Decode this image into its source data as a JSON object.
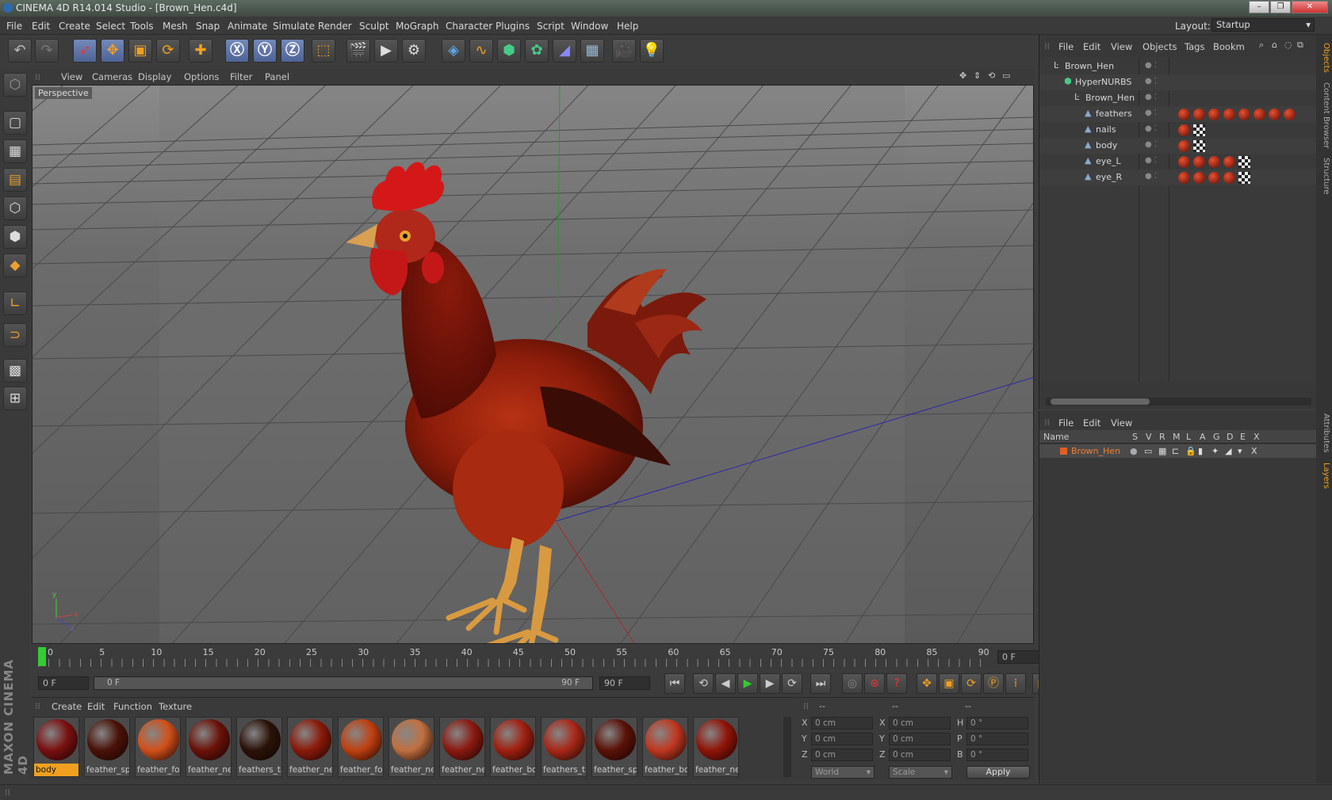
{
  "window": {
    "title": "CINEMA 4D R14.014 Studio - [Brown_Hen.c4d]",
    "layout_label": "Layout:",
    "layout_value": "Startup"
  },
  "menu": [
    "File",
    "Edit",
    "Create",
    "Select",
    "Tools",
    "Mesh",
    "Snap",
    "Animate",
    "Simulate",
    "Render",
    "Sculpt",
    "MoGraph",
    "Character",
    "Plugins",
    "Script",
    "Window",
    "Help"
  ],
  "toolbar_icons": [
    "undo-icon",
    "redo-icon",
    "live-select-icon",
    "move-icon",
    "scale-icon",
    "rotate-icon",
    "add-icon",
    "x-axis-icon",
    "y-axis-icon",
    "z-axis-icon",
    "coordinate-system-icon",
    "render-view-icon",
    "render-picture-icon",
    "render-settings-icon",
    "cube-icon",
    "spline-icon",
    "nurbs-icon",
    "array-icon",
    "deformer-icon",
    "floor-icon",
    "camera-icon",
    "light-icon"
  ],
  "viewport": {
    "menu": [
      "View",
      "Cameras",
      "Display",
      "Options",
      "Filter",
      "Panel"
    ],
    "label": "Perspective",
    "axis_labels": {
      "x": "x",
      "y": "y",
      "z": "z"
    }
  },
  "timeline": {
    "ticks": [
      "0",
      "5",
      "10",
      "15",
      "20",
      "25",
      "30",
      "35",
      "40",
      "45",
      "50",
      "55",
      "60",
      "65",
      "70",
      "75",
      "80",
      "85",
      "90"
    ],
    "current_frame": "0 F"
  },
  "transport": {
    "start": "0 F",
    "range_start": "0 F",
    "range_end": "90 F",
    "end": "90 F"
  },
  "materials": {
    "menu": [
      "Create",
      "Edit",
      "Function",
      "Texture"
    ],
    "items": [
      {
        "name": "body",
        "color": "#7a1010",
        "selected": true
      },
      {
        "name": "feather_spi",
        "color": "#4a1208"
      },
      {
        "name": "feather_foo",
        "color": "#d0501a"
      },
      {
        "name": "feather_ne",
        "color": "#6a1208"
      },
      {
        "name": "feathers_ta",
        "color": "#2a1208"
      },
      {
        "name": "feather_ne",
        "color": "#8a1a0a"
      },
      {
        "name": "feather_foo",
        "color": "#c04010"
      },
      {
        "name": "feather_ne",
        "color": "#c07040"
      },
      {
        "name": "feather_ne",
        "color": "#8a1a10"
      },
      {
        "name": "feather_bo",
        "color": "#a02010"
      },
      {
        "name": "feathers_ta",
        "color": "#a82818"
      },
      {
        "name": "feather_spi",
        "color": "#5a1208"
      },
      {
        "name": "feather_bo",
        "color": "#c03820"
      },
      {
        "name": "feather_ne",
        "color": "#901408"
      }
    ]
  },
  "coords": {
    "headers": [
      "--",
      "--",
      "--"
    ],
    "pos": [
      {
        "axis": "X",
        "value": "0 cm"
      },
      {
        "axis": "Y",
        "value": "0 cm"
      },
      {
        "axis": "Z",
        "value": "0 cm"
      }
    ],
    "size": [
      {
        "axis": "X",
        "value": "0 cm"
      },
      {
        "axis": "Y",
        "value": "0 cm"
      },
      {
        "axis": "Z",
        "value": "0 cm"
      }
    ],
    "rot": [
      {
        "axis": "H",
        "value": "0 °"
      },
      {
        "axis": "P",
        "value": "0 °"
      },
      {
        "axis": "B",
        "value": "0 °"
      }
    ],
    "mode1": "World",
    "mode2": "Scale",
    "apply": "Apply"
  },
  "objects": {
    "menu": [
      "File",
      "Edit",
      "View",
      "Objects",
      "Tags",
      "Bookm"
    ],
    "tree": [
      {
        "name": "Brown_Hen",
        "depth": 0
      },
      {
        "name": "HyperNURBS",
        "depth": 1
      },
      {
        "name": "Brown_Hen",
        "depth": 2
      },
      {
        "name": "feathers",
        "depth": 3
      },
      {
        "name": "nails",
        "depth": 3
      },
      {
        "name": "body",
        "depth": 3
      },
      {
        "name": "eye_L",
        "depth": 3
      },
      {
        "name": "eye_R",
        "depth": 3
      }
    ]
  },
  "layers": {
    "menu": [
      "File",
      "Edit",
      "View"
    ],
    "columns": [
      "Name",
      "S",
      "V",
      "R",
      "M",
      "L",
      "A",
      "G",
      "D",
      "E",
      "X"
    ],
    "rows": [
      {
        "name": "Brown_Hen",
        "color": "#e06020"
      }
    ]
  },
  "side_tabs": [
    "Objects",
    "Content Browser",
    "Structure",
    "Attributes",
    "Layers"
  ],
  "brand": "MAXON CINEMA 4D"
}
